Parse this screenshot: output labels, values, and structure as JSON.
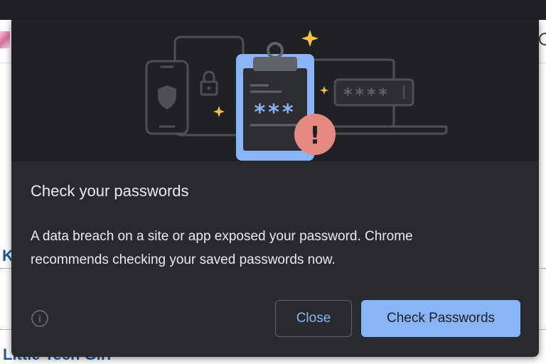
{
  "background": {
    "links": [
      "K",
      "Little Tech Girl"
    ]
  },
  "dialog": {
    "title": "Check your passwords",
    "body": "A data breach on a site or app exposed your password. Chrome recommends checking your saved passwords now.",
    "info_icon": "info-icon",
    "buttons": {
      "close": "Close",
      "check": "Check Passwords"
    },
    "illustration": {
      "clipboard_mask": "***",
      "field_mask": "****",
      "alert_symbol": "!"
    }
  },
  "colors": {
    "dialog_bg": "#292a2d",
    "illustration_bg": "#202124",
    "accent_blue": "#8ab4f8",
    "text": "#e8eaed",
    "alert_red": "#e58a82",
    "sparkle": "#f6c345"
  }
}
